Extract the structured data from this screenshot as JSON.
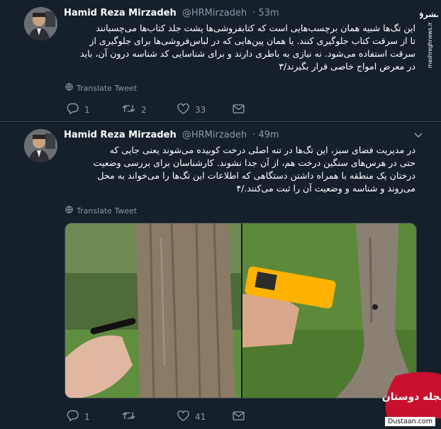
{
  "tweets": [
    {
      "author_name": "Hamid Reza Mirzadeh",
      "author_handle": "@HRMirzadeh",
      "time": "· 53m",
      "text_lines": [
        "این تگ‌ها شبیه همان برچسب‌هایی است که کتابفروشی‌ها پشت جلد کتاب‌ها می‌چسبانند",
        "تا از سرقت کتاب جلوگیری کنند. یا همان پین‌هایی که در لباس‌فروشی‌ها برای جلوگیری از",
        "سرقت استفاده می‌شود. نه نیازی به باطری دارند و برای شناسایی کد شناسه درون آن، باید",
        "در معرض امواج خاصی قرار بگیرند/۳"
      ],
      "translate_label": "Translate Tweet",
      "reply_count": "1",
      "retweet_count": "2",
      "like_count": "33"
    },
    {
      "author_name": "Hamid Reza Mirzadeh",
      "author_handle": "@HRMirzadeh",
      "time": "· 49m",
      "text_lines": [
        "در مدیریت فضای سبز، این تگ‌ها در تنه اصلی درخت کوبیده می‌شوند یعنی جایی که",
        "حتی در هرس‌های سنگین درخت هم، از آن جدا نشوند. کارشناسان برای بررسی وضعیت",
        "درختان یک منطقه با همراه داشتن دستگاهی که اطلاعات این تگ‌ها را می‌خواند به محل",
        "می‌روند و شناسه و وضعیت آن را ثبت می‌کنند./۴"
      ],
      "translate_label": "Translate Tweet",
      "reply_count": "1",
      "retweet_count": "",
      "like_count": "41"
    }
  ],
  "side_logo_text": "mashreghnews.ir",
  "watermark_url": "Dustaan.com",
  "watermark_brand": "مجله دوستان",
  "colors": {
    "background": "#15202b",
    "divider": "#38444d",
    "muted": "#8899a6",
    "brand_red": "#c8102e"
  }
}
